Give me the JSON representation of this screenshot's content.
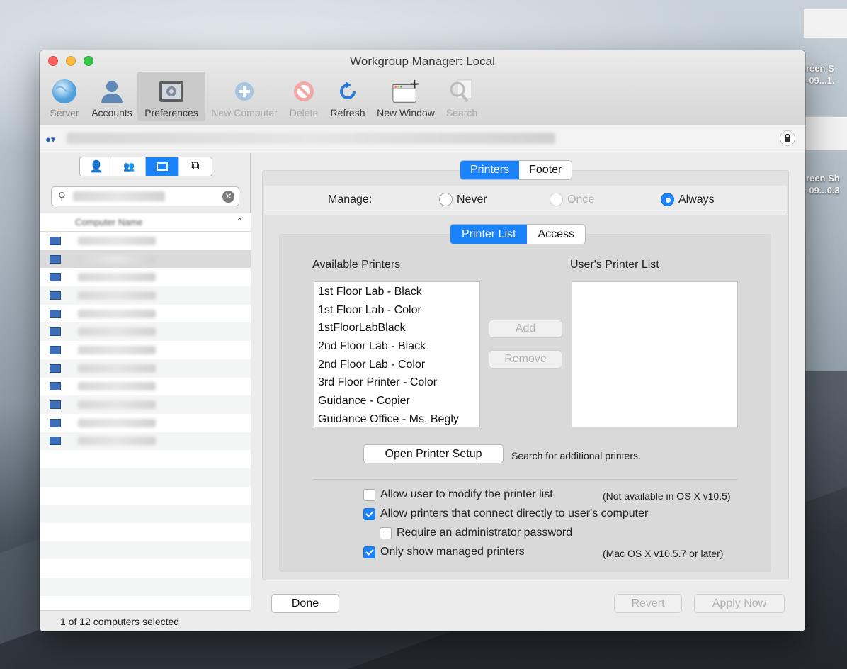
{
  "window": {
    "title": "Workgroup Manager: Local"
  },
  "toolbar": {
    "items": [
      {
        "label": "Server",
        "icon": "globe-icon",
        "state": "disabled"
      },
      {
        "label": "Accounts",
        "icon": "person-icon",
        "state": "normal"
      },
      {
        "label": "Preferences",
        "icon": "preferences-panel-icon",
        "state": "selected"
      },
      {
        "label": "New Computer",
        "icon": "plus-circle-icon",
        "state": "disabled"
      },
      {
        "label": "Delete",
        "icon": "no-entry-icon",
        "state": "disabled"
      },
      {
        "label": "Refresh",
        "icon": "refresh-icon",
        "state": "normal"
      },
      {
        "label": "New Window",
        "icon": "new-window-icon",
        "state": "normal"
      },
      {
        "label": "Search",
        "icon": "magnifier-icon",
        "state": "disabled"
      }
    ]
  },
  "sidebar": {
    "list_header": "Computer Name",
    "status": "1 of 12 computers selected"
  },
  "tabs": {
    "top": [
      "Printers",
      "Footer"
    ],
    "inner": [
      "Printer List",
      "Access"
    ]
  },
  "manage": {
    "label": "Manage:",
    "options": [
      "Never",
      "Once",
      "Always"
    ],
    "selected": "Always"
  },
  "printers": {
    "available_heading": "Available Printers",
    "user_heading": "User's Printer List",
    "available": [
      "1st Floor Lab - Black",
      "1st Floor Lab - Color",
      "1stFloorLabBlack",
      "2nd Floor Lab - Black",
      "2nd Floor Lab - Color",
      "3rd Floor Printer - Color",
      "Guidance - Copier",
      "Guidance Office - Ms. Begly"
    ],
    "add_label": "Add",
    "remove_label": "Remove",
    "open_setup_label": "Open Printer Setup",
    "search_hint": "Search for additional printers."
  },
  "options": {
    "allow_modify": "Allow user to modify the printer list",
    "allow_modify_note": "(Not available in OS X v10.5)",
    "allow_direct": "Allow printers that connect directly to user's computer",
    "require_admin": "Require an administrator password",
    "only_managed": "Only show managed printers",
    "only_managed_note": "(Mac OS X v10.5.7 or later)"
  },
  "footer": {
    "done": "Done",
    "revert": "Revert",
    "apply": "Apply Now"
  },
  "desktop": {
    "label1a": "reen S",
    "label1b": "-09...1.",
    "label2a": "reen Sh",
    "label2b": "-09...0.3"
  },
  "colors": {
    "accent": "#1a82fb"
  }
}
